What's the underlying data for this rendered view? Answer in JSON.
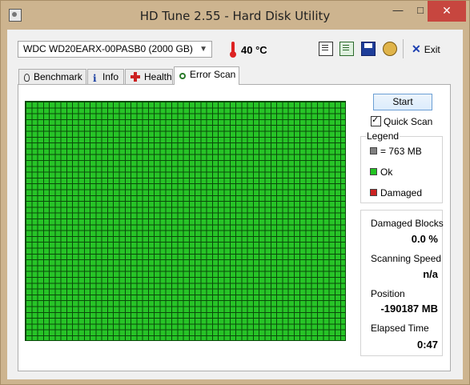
{
  "window": {
    "title": "HD Tune 2.55 - Hard Disk Utility",
    "min_glyph": "—",
    "max_glyph": "□",
    "close_glyph": "✕"
  },
  "toolbar": {
    "drive": "WDC WD20EARX-00PASB0 (2000 GB)",
    "temperature": "40 °C",
    "exit_label": "Exit",
    "icons": [
      "copy-text-icon",
      "copy-screenshot-icon",
      "save-icon",
      "options-icon",
      "exit-icon"
    ]
  },
  "tabs": [
    {
      "label": "Benchmark",
      "icon": "bulb-icon",
      "active": false
    },
    {
      "label": "Info",
      "icon": "info-icon",
      "active": false
    },
    {
      "label": "Health",
      "icon": "health-cross-icon",
      "active": false
    },
    {
      "label": "Error Scan",
      "icon": "magnifier-icon",
      "active": true
    }
  ],
  "scan": {
    "start_label": "Start",
    "quick_scan_label": "Quick Scan",
    "quick_scan_checked": true,
    "legend_title": "Legend",
    "legend": [
      {
        "label": "= 763 MB",
        "color": "#808080"
      },
      {
        "label": "Ok",
        "color": "#22c422"
      },
      {
        "label": "Damaged",
        "color": "#cc2222"
      }
    ],
    "block_color": "#27c427",
    "stats": {
      "damaged_blocks_label": "Damaged Blocks",
      "damaged_blocks_value": "0.0 %",
      "scanning_speed_label": "Scanning Speed",
      "scanning_speed_value": "n/a",
      "position_label": "Position",
      "position_value": "-190187 MB",
      "elapsed_label": "Elapsed Time",
      "elapsed_value": "0:47"
    }
  }
}
